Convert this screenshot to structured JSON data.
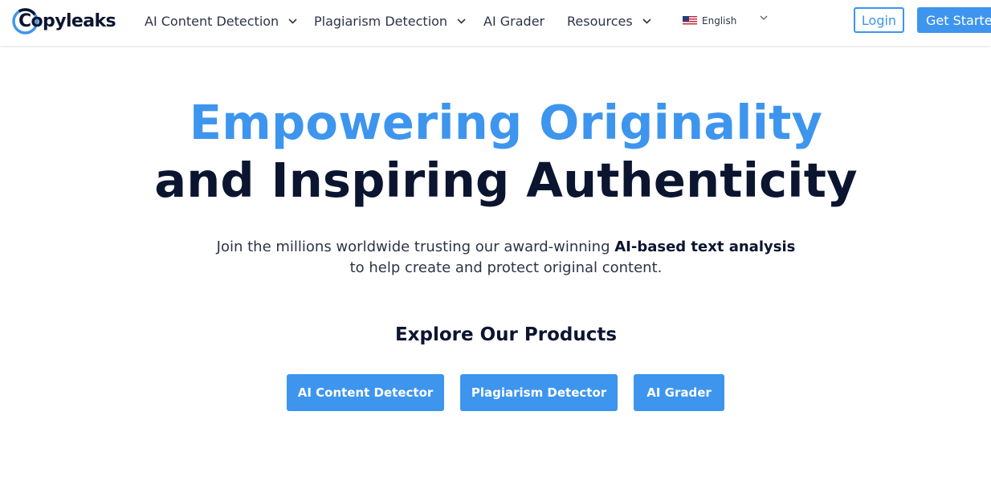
{
  "brand": {
    "name": "Copyleaks",
    "logo_icon": "copyleaks-logo-icon",
    "primary_color": "#3d95ee",
    "dark_color": "#0b1530"
  },
  "nav": {
    "items": [
      {
        "label": "AI Content Detection",
        "has_dropdown": true
      },
      {
        "label": "Plagiarism Detection",
        "has_dropdown": true
      },
      {
        "label": "AI Grader",
        "has_dropdown": false
      },
      {
        "label": "Resources",
        "has_dropdown": true
      }
    ],
    "language": {
      "label": "English",
      "flag_icon": "us-flag-icon"
    },
    "login_label": "Login",
    "get_started_label": "Get Started"
  },
  "hero": {
    "headline_line1": "Empowering Originality",
    "headline_line2": "and Inspiring Authenticity",
    "subtitle_part1": "Join the millions worldwide trusting our award-winning ",
    "subtitle_bold": "AI-based text analysis",
    "subtitle_line2": "to help create and protect original content."
  },
  "products": {
    "heading": "Explore Our Products",
    "buttons": [
      {
        "label": "AI Content Detector"
      },
      {
        "label": "Plagiarism Detector"
      },
      {
        "label": "AI Grader"
      }
    ]
  }
}
